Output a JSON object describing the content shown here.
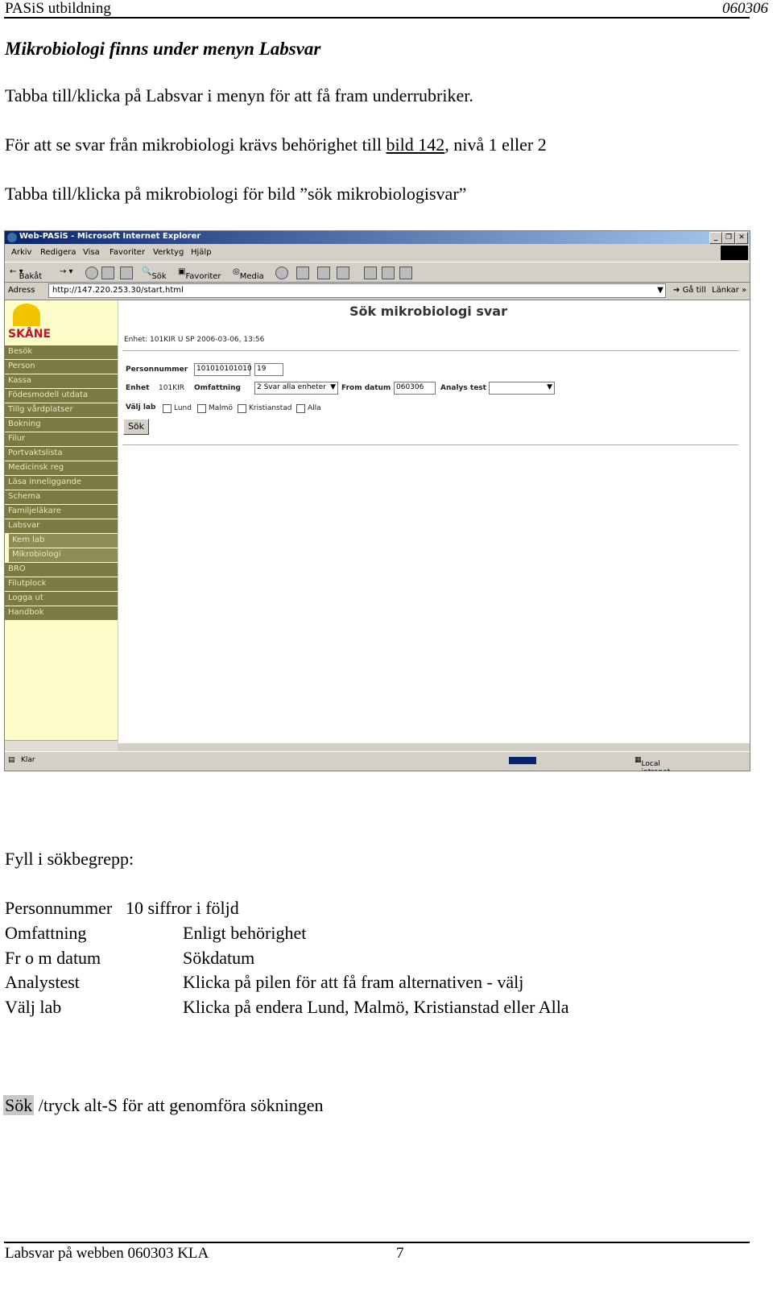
{
  "header": {
    "left": "PASiS utbildning",
    "right": "060306"
  },
  "heading": "Mikrobiologi finns under menyn Labsvar",
  "intro": {
    "p1": "Tabba till/klicka på Labsvar i menyn för att få fram underrubriker.",
    "p2_before": "För att se svar från mikrobiologi krävs behörighet till ",
    "p2_link": "bild 142",
    "p2_after": ",  nivå 1 eller 2",
    "p3": "Tabba till/klicka på mikrobiologi för bild ”sök mikrobiologisvar”"
  },
  "browser": {
    "window_title": "Web-PASiS - Microsoft Internet Explorer",
    "window_buttons": [
      "_",
      "❐",
      "✕"
    ],
    "menu": [
      "Arkiv",
      "Redigera",
      "Visa",
      "Favoriter",
      "Verktyg",
      "Hjälp"
    ],
    "toolbar": {
      "back": "Bakåt",
      "search": "Sök",
      "favorites": "Favoriter",
      "media": "Media"
    },
    "address_label": "Adress",
    "address": "http://147.220.253.30/start.html",
    "goto": "Gå till",
    "links": "Länkar",
    "logo": "SKÅNE",
    "nav": [
      "Besök",
      "Person",
      "Kassa",
      "Födesmodell utdata",
      "Tillg vårdplatser",
      "Bokning",
      "Filur",
      "Portvaktslista",
      "Medicinsk reg",
      "Läsa inneliggande",
      "Schema",
      "Familjeläkare",
      "Labsvar"
    ],
    "nav_sub": [
      "Kem lab",
      "Mikrobiologi"
    ],
    "nav_after": [
      "BRO",
      "Filutplock",
      "Logga ut",
      "Handbok"
    ],
    "form": {
      "title": "Sök mikrobiologi svar",
      "unit_line": "Enhet: 101KIR      U    SP       2006-03-06, 13:56",
      "personnummer_label": "Personnummer",
      "personnummer_value": "101010101010",
      "personnummer_suffix": "19",
      "enhet_label": "Enhet",
      "enhet_value": "101KIR",
      "omfattning_label": "Omfattning",
      "omfattning_value": "2 Svar alla enheter",
      "from_label": "From datum",
      "from_value": "060306",
      "analys_label": "Analys test",
      "valj_lab_label": "Välj lab",
      "labs": [
        "Lund",
        "Malmö",
        "Kristianstad",
        "Alla"
      ],
      "sok_button": "Sök"
    },
    "status_left": "Klar",
    "status_right": "Local intranet"
  },
  "fill_title": "Fyll i sökbegrepp:",
  "fields": [
    {
      "label": "Personnummer",
      "desc": "10 siffror i följd"
    },
    {
      "label": "Omfattning",
      "desc": "Enligt behörighet"
    },
    {
      "label": "Fr o m datum",
      "desc": "Sökdatum"
    },
    {
      "label": "Analystest",
      "desc": "Klicka på pilen för att få fram alternativen - välj"
    },
    {
      "label": "Välj lab",
      "desc": "Klicka på endera Lund, Malmö, Kristianstad eller Alla"
    }
  ],
  "sok_line": {
    "button": "Sök",
    "text": " /tryck alt-S för att genomföra sökningen"
  },
  "footer": {
    "left": "Labsvar på webben 060303 KLA",
    "page": "7"
  }
}
